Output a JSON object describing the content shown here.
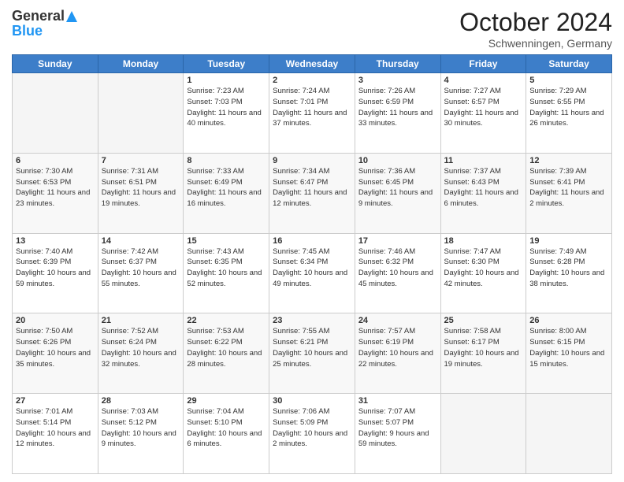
{
  "header": {
    "logo_general": "General",
    "logo_blue": "Blue",
    "month": "October 2024",
    "location": "Schwenningen, Germany"
  },
  "days_of_week": [
    "Sunday",
    "Monday",
    "Tuesday",
    "Wednesday",
    "Thursday",
    "Friday",
    "Saturday"
  ],
  "weeks": [
    [
      {
        "day": "",
        "sunrise": "",
        "sunset": "",
        "daylight": ""
      },
      {
        "day": "",
        "sunrise": "",
        "sunset": "",
        "daylight": ""
      },
      {
        "day": "1",
        "sunrise": "Sunrise: 7:23 AM",
        "sunset": "Sunset: 7:03 PM",
        "daylight": "Daylight: 11 hours and 40 minutes."
      },
      {
        "day": "2",
        "sunrise": "Sunrise: 7:24 AM",
        "sunset": "Sunset: 7:01 PM",
        "daylight": "Daylight: 11 hours and 37 minutes."
      },
      {
        "day": "3",
        "sunrise": "Sunrise: 7:26 AM",
        "sunset": "Sunset: 6:59 PM",
        "daylight": "Daylight: 11 hours and 33 minutes."
      },
      {
        "day": "4",
        "sunrise": "Sunrise: 7:27 AM",
        "sunset": "Sunset: 6:57 PM",
        "daylight": "Daylight: 11 hours and 30 minutes."
      },
      {
        "day": "5",
        "sunrise": "Sunrise: 7:29 AM",
        "sunset": "Sunset: 6:55 PM",
        "daylight": "Daylight: 11 hours and 26 minutes."
      }
    ],
    [
      {
        "day": "6",
        "sunrise": "Sunrise: 7:30 AM",
        "sunset": "Sunset: 6:53 PM",
        "daylight": "Daylight: 11 hours and 23 minutes."
      },
      {
        "day": "7",
        "sunrise": "Sunrise: 7:31 AM",
        "sunset": "Sunset: 6:51 PM",
        "daylight": "Daylight: 11 hours and 19 minutes."
      },
      {
        "day": "8",
        "sunrise": "Sunrise: 7:33 AM",
        "sunset": "Sunset: 6:49 PM",
        "daylight": "Daylight: 11 hours and 16 minutes."
      },
      {
        "day": "9",
        "sunrise": "Sunrise: 7:34 AM",
        "sunset": "Sunset: 6:47 PM",
        "daylight": "Daylight: 11 hours and 12 minutes."
      },
      {
        "day": "10",
        "sunrise": "Sunrise: 7:36 AM",
        "sunset": "Sunset: 6:45 PM",
        "daylight": "Daylight: 11 hours and 9 minutes."
      },
      {
        "day": "11",
        "sunrise": "Sunrise: 7:37 AM",
        "sunset": "Sunset: 6:43 PM",
        "daylight": "Daylight: 11 hours and 6 minutes."
      },
      {
        "day": "12",
        "sunrise": "Sunrise: 7:39 AM",
        "sunset": "Sunset: 6:41 PM",
        "daylight": "Daylight: 11 hours and 2 minutes."
      }
    ],
    [
      {
        "day": "13",
        "sunrise": "Sunrise: 7:40 AM",
        "sunset": "Sunset: 6:39 PM",
        "daylight": "Daylight: 10 hours and 59 minutes."
      },
      {
        "day": "14",
        "sunrise": "Sunrise: 7:42 AM",
        "sunset": "Sunset: 6:37 PM",
        "daylight": "Daylight: 10 hours and 55 minutes."
      },
      {
        "day": "15",
        "sunrise": "Sunrise: 7:43 AM",
        "sunset": "Sunset: 6:35 PM",
        "daylight": "Daylight: 10 hours and 52 minutes."
      },
      {
        "day": "16",
        "sunrise": "Sunrise: 7:45 AM",
        "sunset": "Sunset: 6:34 PM",
        "daylight": "Daylight: 10 hours and 49 minutes."
      },
      {
        "day": "17",
        "sunrise": "Sunrise: 7:46 AM",
        "sunset": "Sunset: 6:32 PM",
        "daylight": "Daylight: 10 hours and 45 minutes."
      },
      {
        "day": "18",
        "sunrise": "Sunrise: 7:47 AM",
        "sunset": "Sunset: 6:30 PM",
        "daylight": "Daylight: 10 hours and 42 minutes."
      },
      {
        "day": "19",
        "sunrise": "Sunrise: 7:49 AM",
        "sunset": "Sunset: 6:28 PM",
        "daylight": "Daylight: 10 hours and 38 minutes."
      }
    ],
    [
      {
        "day": "20",
        "sunrise": "Sunrise: 7:50 AM",
        "sunset": "Sunset: 6:26 PM",
        "daylight": "Daylight: 10 hours and 35 minutes."
      },
      {
        "day": "21",
        "sunrise": "Sunrise: 7:52 AM",
        "sunset": "Sunset: 6:24 PM",
        "daylight": "Daylight: 10 hours and 32 minutes."
      },
      {
        "day": "22",
        "sunrise": "Sunrise: 7:53 AM",
        "sunset": "Sunset: 6:22 PM",
        "daylight": "Daylight: 10 hours and 28 minutes."
      },
      {
        "day": "23",
        "sunrise": "Sunrise: 7:55 AM",
        "sunset": "Sunset: 6:21 PM",
        "daylight": "Daylight: 10 hours and 25 minutes."
      },
      {
        "day": "24",
        "sunrise": "Sunrise: 7:57 AM",
        "sunset": "Sunset: 6:19 PM",
        "daylight": "Daylight: 10 hours and 22 minutes."
      },
      {
        "day": "25",
        "sunrise": "Sunrise: 7:58 AM",
        "sunset": "Sunset: 6:17 PM",
        "daylight": "Daylight: 10 hours and 19 minutes."
      },
      {
        "day": "26",
        "sunrise": "Sunrise: 8:00 AM",
        "sunset": "Sunset: 6:15 PM",
        "daylight": "Daylight: 10 hours and 15 minutes."
      }
    ],
    [
      {
        "day": "27",
        "sunrise": "Sunrise: 7:01 AM",
        "sunset": "Sunset: 5:14 PM",
        "daylight": "Daylight: 10 hours and 12 minutes."
      },
      {
        "day": "28",
        "sunrise": "Sunrise: 7:03 AM",
        "sunset": "Sunset: 5:12 PM",
        "daylight": "Daylight: 10 hours and 9 minutes."
      },
      {
        "day": "29",
        "sunrise": "Sunrise: 7:04 AM",
        "sunset": "Sunset: 5:10 PM",
        "daylight": "Daylight: 10 hours and 6 minutes."
      },
      {
        "day": "30",
        "sunrise": "Sunrise: 7:06 AM",
        "sunset": "Sunset: 5:09 PM",
        "daylight": "Daylight: 10 hours and 2 minutes."
      },
      {
        "day": "31",
        "sunrise": "Sunrise: 7:07 AM",
        "sunset": "Sunset: 5:07 PM",
        "daylight": "Daylight: 9 hours and 59 minutes."
      },
      {
        "day": "",
        "sunrise": "",
        "sunset": "",
        "daylight": ""
      },
      {
        "day": "",
        "sunrise": "",
        "sunset": "",
        "daylight": ""
      }
    ]
  ]
}
